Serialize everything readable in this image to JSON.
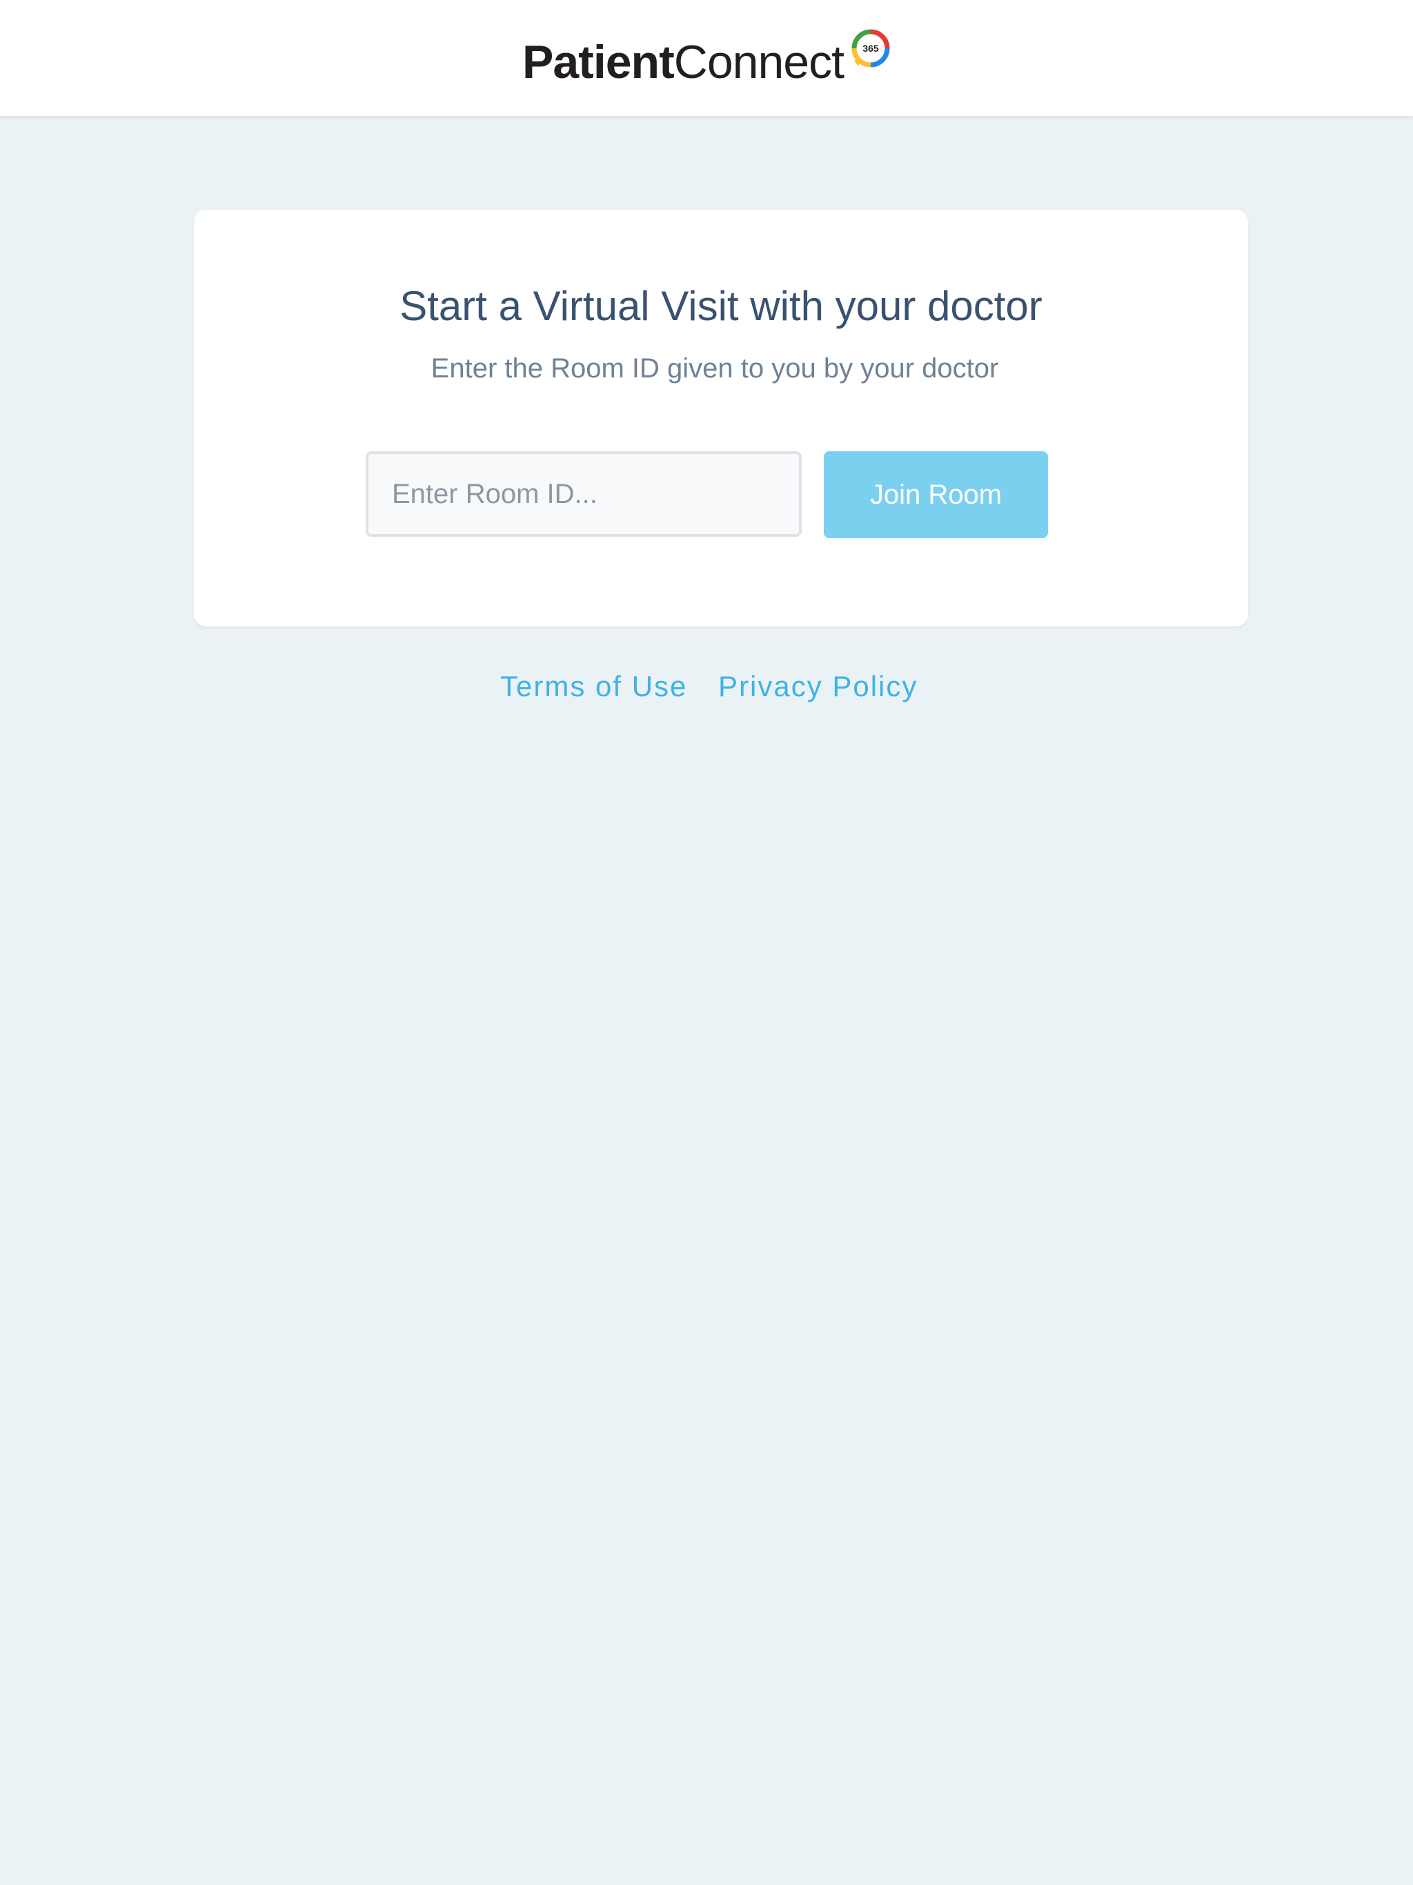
{
  "header": {
    "logo": {
      "text_bold": "Patient",
      "text_light": "Connect",
      "badge_text": "365",
      "badge_colors": [
        "#e53935",
        "#43a047",
        "#1e88e5",
        "#fbc02d"
      ]
    }
  },
  "card": {
    "title": "Start a Virtual Visit with your doctor",
    "subtitle": "Enter the Room ID given to you by your doctor",
    "room_input": {
      "value": "",
      "placeholder": "Enter Room ID..."
    },
    "join_button_label": "Join Room"
  },
  "footer": {
    "links": [
      {
        "label": "Terms of Use"
      },
      {
        "label": "Privacy Policy"
      }
    ]
  },
  "colors": {
    "page_background": "#ebf2f5",
    "accent": "#3fb2e4",
    "button": "#7bd0ef",
    "title": "#3a5270",
    "subtitle": "#6f8295"
  }
}
